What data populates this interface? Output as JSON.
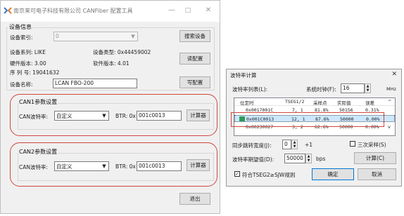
{
  "main_window": {
    "title": "南京来可电子科技有限公司 CANFiber 配置工具",
    "minimize": "—",
    "maximize": "□",
    "close": "✕",
    "device_info": {
      "group_title": "设备信息",
      "index_label": "设备索引:",
      "index_value": "0",
      "search_button": "搜索设备",
      "series_label": "设备系列: LIKE",
      "type_label": "设备类型: 0x44459002",
      "read_button": "读配置",
      "hw_label": "硬件版本: 3.00",
      "sw_label": "软件版本: 4.01",
      "serial_label": "序 列 号: 19041632",
      "name_label": "设备名称:",
      "name_value": "LCAN FBO-200",
      "write_button": "写配置"
    },
    "can1": {
      "group_title": "CAN1参数设置",
      "baud_label": "CAN波特率:",
      "baud_value": "自定义",
      "btr_label": "BTR: 0x",
      "btr_value": "001c0013",
      "calc_button": "计算器"
    },
    "can2": {
      "group_title": "CAN2参数设置",
      "baud_label": "CAN波特率:",
      "baud_value": "自定义",
      "btr_label": "BTR: 0x",
      "btr_value": "001c0013",
      "calc_button": "计算器"
    },
    "exit_button": "退出"
  },
  "calculator": {
    "title": "波特率计算",
    "close": "✕",
    "list_label": "波特率列表(L):",
    "clock_label": "系统时钟(F):",
    "clock_value": "16",
    "clock_unit": "MHz",
    "columns": [
      "位定时",
      "TSEG1/2",
      "采样点",
      "实际值",
      "误差"
    ],
    "rows": [
      {
        "bt": "0x0017001C",
        "tseg": "7, 1",
        "sp": "81.8%",
        "actual": "50156",
        "err": "0.31%",
        "selected": false
      },
      {
        "bt": "0x001C0013",
        "tseg": "12, 1",
        "sp": "87.6%",
        "actual": "50000",
        "err": "0.00%",
        "selected": true
      },
      {
        "bt": "0x00230027",
        "tseg": "3, 2",
        "sp": "62.6%",
        "actual": "50000",
        "err": "0.00%",
        "selected": false
      }
    ],
    "sjw_label": "同步跳转宽度(J):",
    "sjw_value": "0",
    "sjw_suffix": "+1",
    "triple_sample_label": "三次采样(S)",
    "expected_label": "波特率期望值(D):",
    "expected_value": "50000",
    "expected_unit": "bps",
    "calc_button": "计算(C)",
    "conform_label": "符合TSEG2≥SJW规则",
    "ok_button": "确定",
    "cancel_button": "取消",
    "accent_selected": "#cce8ff",
    "highlight_red": "#d0463e",
    "app_icon_green": "#2e9b5d"
  }
}
